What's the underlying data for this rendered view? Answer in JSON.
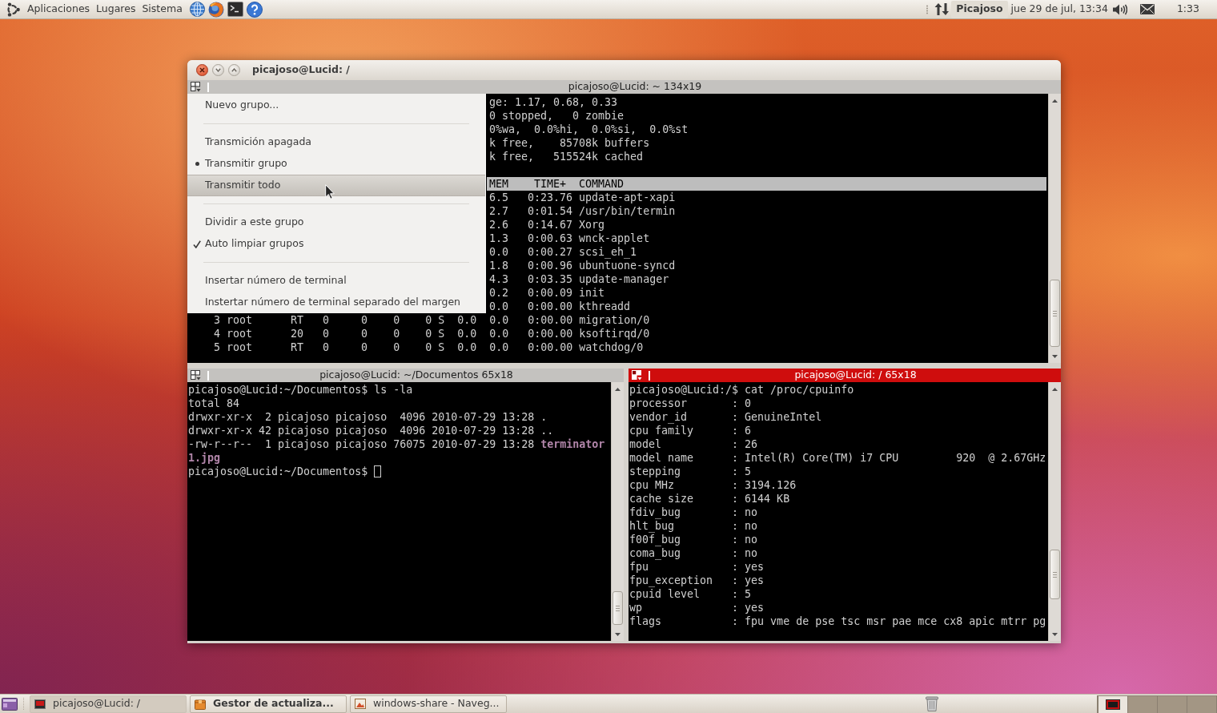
{
  "top_panel": {
    "menus": [
      {
        "label": "Aplicaciones"
      },
      {
        "label": "Lugares"
      },
      {
        "label": "Sistema"
      }
    ],
    "user": "Picajoso",
    "date_time": "jue 29 de jul, 13:34",
    "time": "1:33"
  },
  "window": {
    "title": "picajoso@Lucid: /",
    "top_terminal": {
      "title": "picajoso@Lucid: ~ 134x19",
      "focused": false,
      "summary_lines": [
        "ge: 1.17, 0.68, 0.33",
        "0 stopped,   0 zombie",
        "0%wa,  0.0%hi,  0.0%si,  0.0%st",
        "k free,    85708k buffers",
        "k free,   515524k cached"
      ],
      "header": "MEM    TIME+  COMMAND",
      "process_lines": [
        "6.5   0:23.76 update-apt-xapi",
        "2.7   0:01.54 /usr/bin/termin",
        "2.6   0:14.67 Xorg",
        "1.3   0:00.63 wnck-applet",
        "0.0   0:00.27 scsi_eh_1",
        "1.8   0:00.96 ubuntuone-syncd",
        "4.3   0:03.35 update-manager",
        "0.2   0:00.09 init",
        "0.0   0:00.00 kthreadd"
      ],
      "lines": [
        "3 root      RT   0     0    0    0 S  0.0  0.0   0:00.00 migration/0",
        "4 root      20   0     0    0    0 S  0.0  0.0   0:00.00 ksoftirqd/0",
        "5 root      RT   0     0    0    0 S  0.0  0.0   0:00.00 watchdog/0"
      ]
    },
    "group_menu": {
      "items": [
        {
          "kind": "action",
          "label": "Nuevo grupo...",
          "highlighted": false
        },
        {
          "kind": "separator"
        },
        {
          "kind": "radio",
          "label": "Transmición apagada",
          "selected": false,
          "highlighted": false
        },
        {
          "kind": "radio",
          "label": "Transmitir grupo",
          "selected": true,
          "highlighted": false
        },
        {
          "kind": "radio",
          "label": "Transmitir todo",
          "selected": false,
          "highlighted": true
        },
        {
          "kind": "separator"
        },
        {
          "kind": "action",
          "label": "Dividir a este grupo",
          "highlighted": false
        },
        {
          "kind": "check",
          "label": "Auto limpiar grupos",
          "checked": true,
          "highlighted": false
        },
        {
          "kind": "separator"
        },
        {
          "kind": "action",
          "label": "Insertar número de terminal",
          "highlighted": false
        },
        {
          "kind": "action",
          "label": "Instertar número de terminal separado del margen",
          "highlighted": false
        }
      ]
    },
    "left_terminal": {
      "title": "picajoso@Lucid: ~/Documentos 65x18",
      "focused": false,
      "cursor": true,
      "lines": [
        {
          "text": "picajoso@Lucid:~/Documentos$ ls -la"
        },
        {
          "text": "total 84"
        },
        {
          "text": "drwxr-xr-x  2 picajoso picajoso  4096 2010-07-29 13:28 ."
        },
        {
          "text": "drwxr-xr-x 42 picajoso picajoso  4096 2010-07-29 13:28 .."
        },
        {
          "text": "-rw-r--r--  1 picajoso picajoso 76075 2010-07-29 13:28",
          "file_name": "terminator"
        },
        {
          "file_name": "1.jpg"
        },
        {
          "text": "picajoso@Lucid:~/Documentos$"
        }
      ]
    },
    "right_terminal": {
      "title": "picajoso@Lucid: / 65x18",
      "focused": true,
      "lines": [
        {
          "text": "picajoso@Lucid:/$ cat /proc/cpuinfo"
        },
        {
          "text": "processor       : 0"
        },
        {
          "text": "vendor_id       : GenuineIntel"
        },
        {
          "text": "cpu family      : 6"
        },
        {
          "text": "model           : 26"
        },
        {
          "text": "model name      : Intel(R) Core(TM) i7 CPU         920  @ 2.67GHz"
        },
        {
          "text": "stepping        : 5"
        },
        {
          "text": "cpu MHz         : 3194.126"
        },
        {
          "text": "cache size      : 6144 KB"
        },
        {
          "text": "fdiv_bug        : no"
        },
        {
          "text": "hlt_bug         : no"
        },
        {
          "text": "f00f_bug        : no"
        },
        {
          "text": "coma_bug        : no"
        },
        {
          "text": "fpu             : yes"
        },
        {
          "text": "fpu_exception   : yes"
        },
        {
          "text": "cpuid level     : 5"
        },
        {
          "text": "wp              : yes"
        },
        {
          "text": "flags           : fpu vme de pse tsc msr pae mce cx8 apic mtrr pg"
        }
      ]
    }
  },
  "taskbar": {
    "tasks": [
      {
        "kind": "terminal",
        "label": "picajoso@Lucid: /",
        "selected": true,
        "needs_attention": false
      },
      {
        "kind": "updates",
        "label": "Gestor de actualiza...",
        "selected": false,
        "needs_attention": true
      },
      {
        "kind": "file_browser",
        "label": "windows-share - Naveg...",
        "selected": false,
        "needs_attention": false
      }
    ],
    "workspaces": [
      {
        "selected": true
      },
      {
        "selected": false
      },
      {
        "selected": false
      },
      {
        "selected": false
      }
    ]
  }
}
